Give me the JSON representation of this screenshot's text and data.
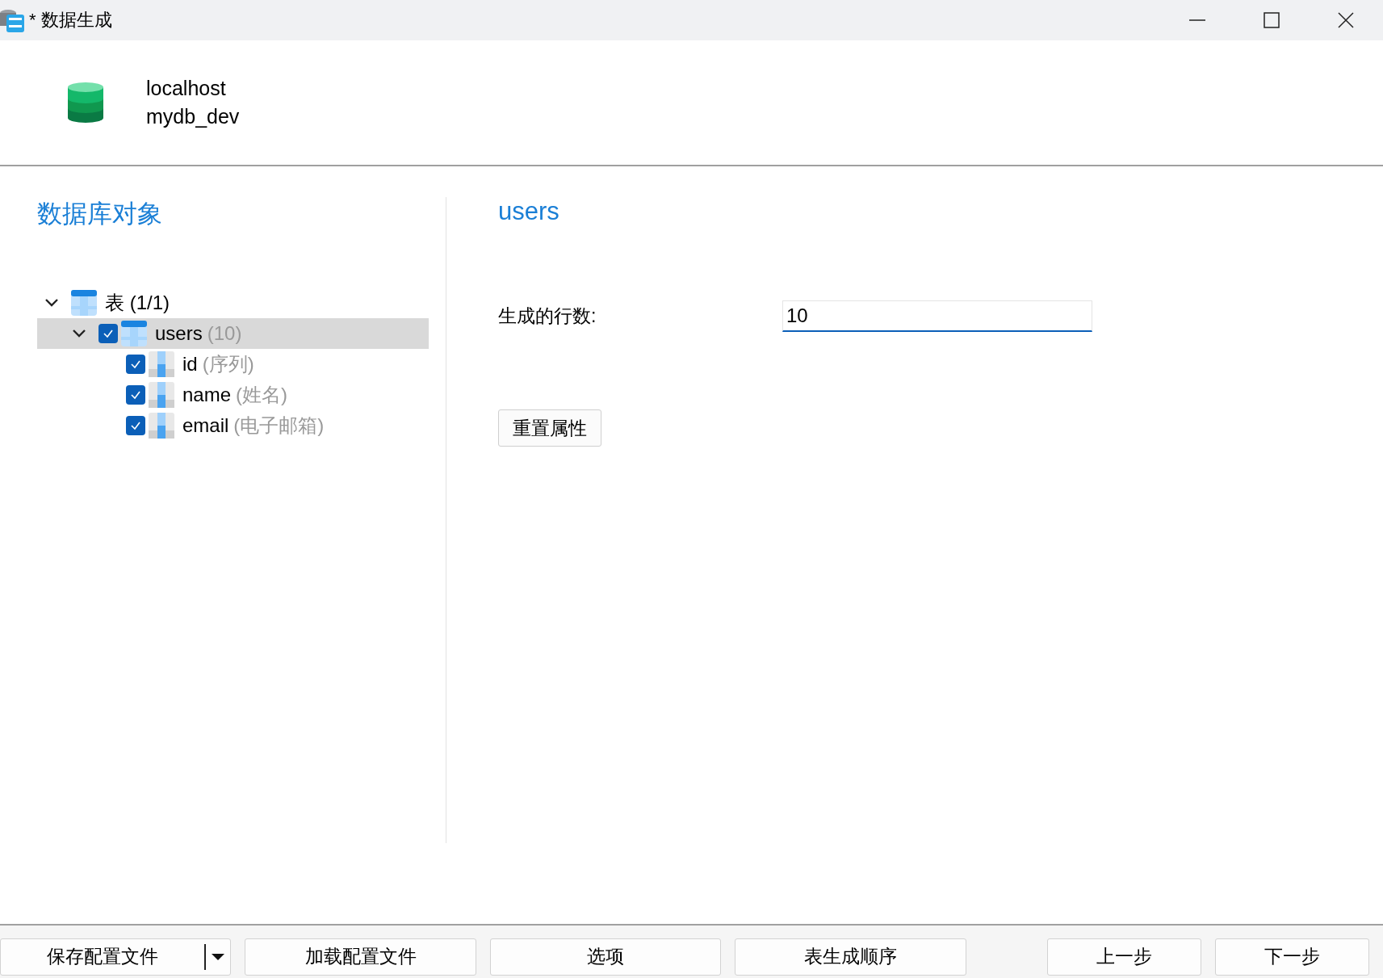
{
  "window": {
    "title": "* 数据生成"
  },
  "connection": {
    "host": "localhost",
    "database": "mydb_dev"
  },
  "left_panel": {
    "title": "数据库对象",
    "tree": [
      {
        "kind": "group",
        "label": "表 (1/1)",
        "expanded": true,
        "selected": false,
        "children": [
          {
            "kind": "table",
            "label": "users",
            "hint": "(10)",
            "expanded": true,
            "checked": true,
            "selected": true,
            "children": [
              {
                "kind": "column",
                "label": "id",
                "hint": "(序列)",
                "checked": true,
                "selected": false
              },
              {
                "kind": "column",
                "label": "name",
                "hint": "(姓名)",
                "checked": true,
                "selected": false
              },
              {
                "kind": "column",
                "label": "email",
                "hint": "(电子邮箱)",
                "checked": true,
                "selected": false
              }
            ]
          }
        ]
      }
    ]
  },
  "right_panel": {
    "title": "users",
    "row_count_label": "生成的行数:",
    "row_count_value": "10",
    "reset_button": "重置属性"
  },
  "footer": {
    "save_button": "保存配置文件",
    "load_button": "加载配置文件",
    "options_button": "选项",
    "order_button": "表生成顺序",
    "back_button": "上一步",
    "next_button": "下一步"
  }
}
